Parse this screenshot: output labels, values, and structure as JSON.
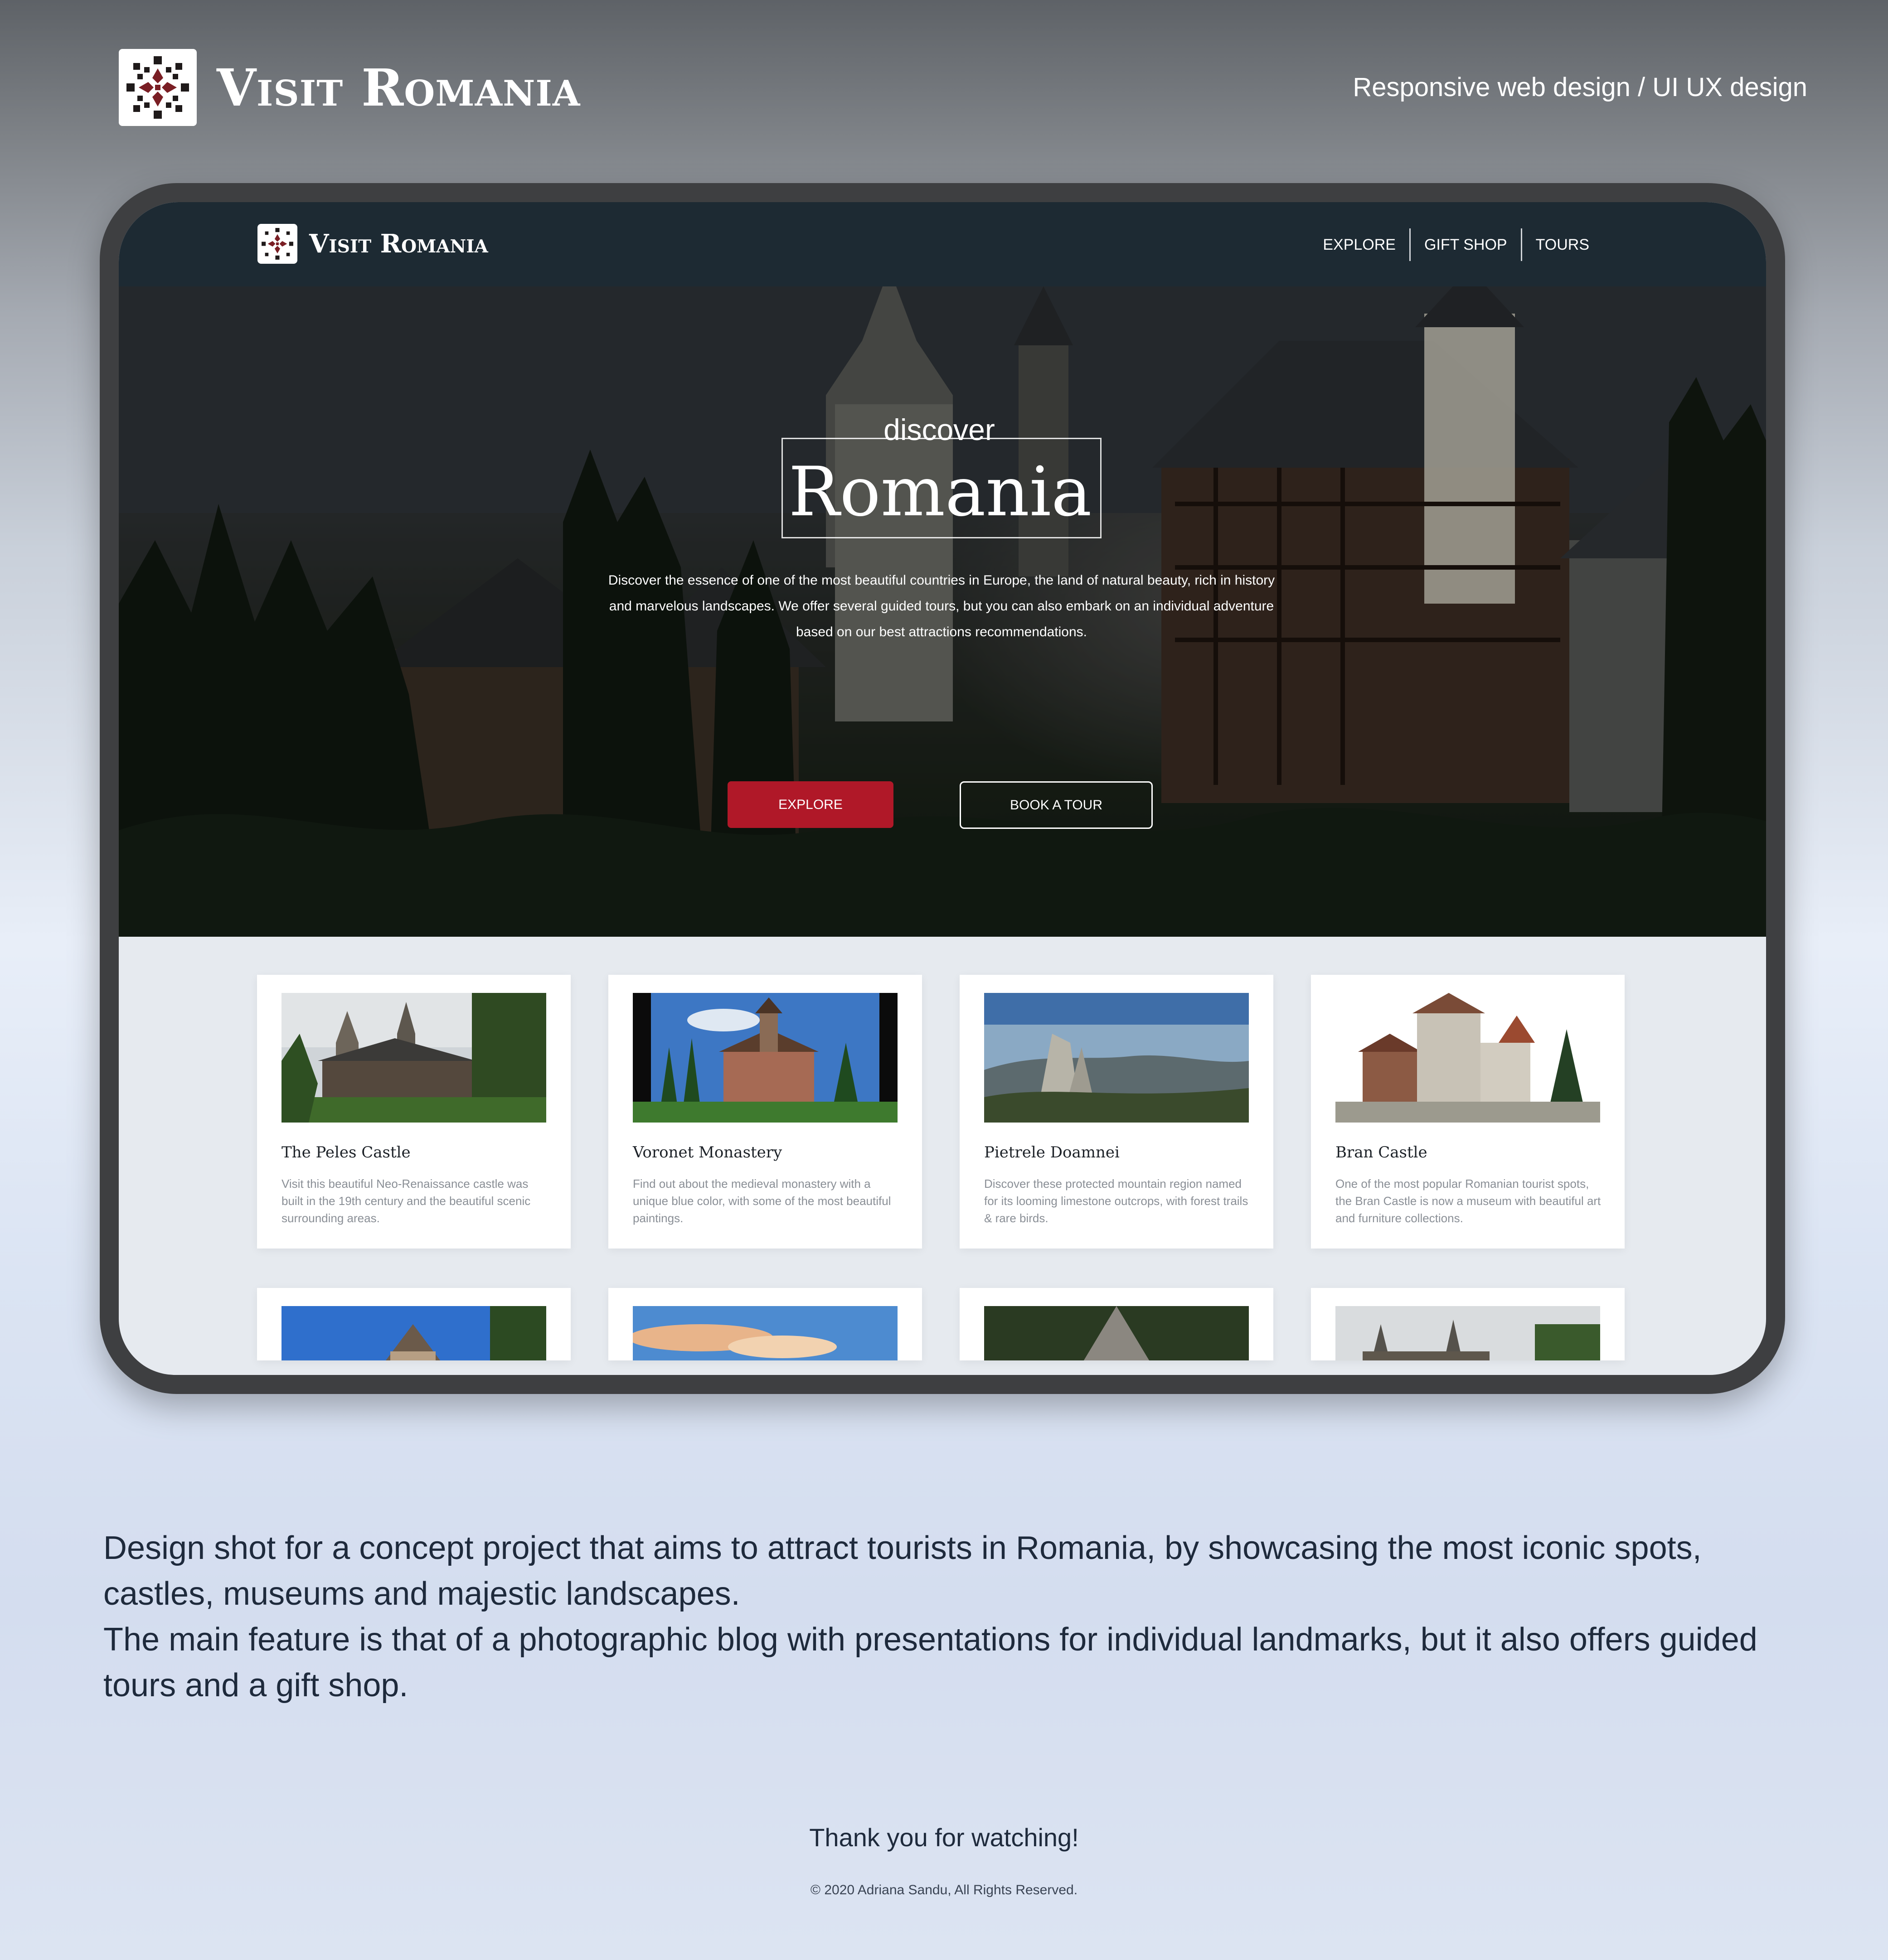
{
  "header": {
    "brand": "Visit Romania",
    "tagline": "Responsive web design / UI UX design",
    "logo_icon": "romanian-motif-icon"
  },
  "mockup": {
    "brand": "Visit Romania",
    "nav": [
      "EXPLORE",
      "GIFT SHOP",
      "TOURS"
    ],
    "hero": {
      "kicker": "discover",
      "title": "Romania",
      "text": "Discover the essence of one of the most beautiful countries in Europe, the land of natural beauty, rich in history and marvelous landscapes. We offer several guided tours, but you can also embark on an individual adventure based on our best attractions recommendations.",
      "primary_button": "EXPLORE",
      "secondary_button": "BOOK A TOUR"
    },
    "cards": [
      {
        "title": "The Peles Castle",
        "text": "Visit this beautiful Neo-Renaissance castle was built in the 19th century and the beautiful scenic surrounding areas."
      },
      {
        "title": "Voronet Monastery",
        "text": "Find out about the medieval monastery with a unique blue color, with some of the most beautiful paintings."
      },
      {
        "title": "Pietrele Doamnei",
        "text": "Discover these protected mountain region named for its looming limestone outcrops, with forest trails & rare birds."
      },
      {
        "title": "Bran Castle",
        "text": "One of the most popular Romanian tourist spots, the Bran Castle is now a museum with beautiful art and furniture collections."
      }
    ]
  },
  "description": {
    "p1": "Design shot for a concept project that aims to attract tourists in Romania, by showcasing the most iconic spots, castles, museums and majestic landscapes.",
    "p2": "The main feature is that of a photographic blog with presentations for individual landmarks, but it also offers guided tours and a gift shop."
  },
  "footer": {
    "thanks": "Thank you for watching!",
    "copyright": "© 2020 Adriana Sandu, All Rights Reserved."
  },
  "colors": {
    "accent_red": "#b01828",
    "navbar": "#1d2a33",
    "device_frame": "#3e3f41"
  }
}
